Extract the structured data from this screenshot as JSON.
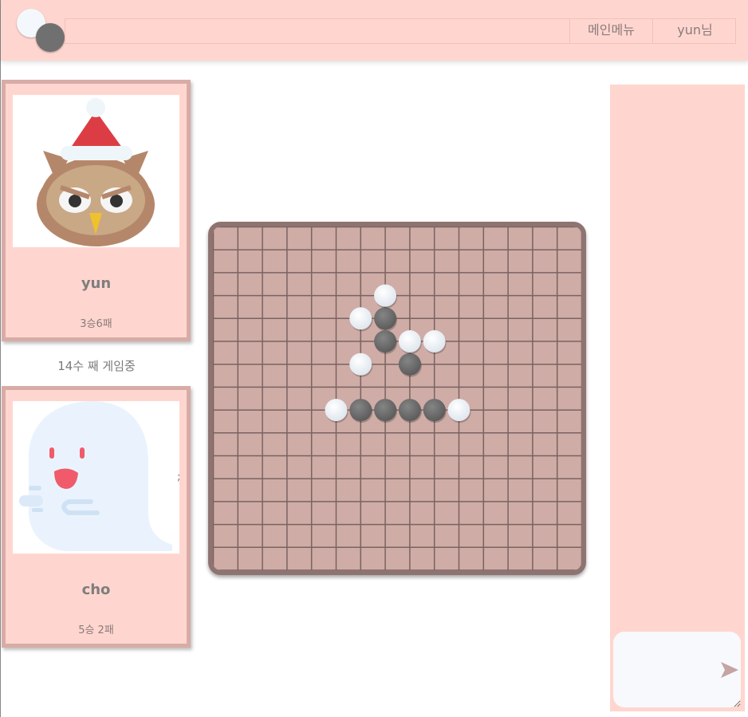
{
  "header": {
    "menu_label": "메인메뉴",
    "user_label": "yun님"
  },
  "players": [
    {
      "name": "yun",
      "record": "3승6패",
      "avatar": "owl-santa-hat-icon"
    },
    {
      "name": "cho",
      "record": "5승 2패",
      "avatar": "ghost-icon"
    }
  ],
  "game": {
    "status": "14수 째 게임중",
    "black_stones": [
      [
        7,
        4
      ],
      [
        7,
        5
      ],
      [
        8,
        6
      ],
      [
        6,
        8
      ],
      [
        7,
        8
      ],
      [
        8,
        8
      ],
      [
        9,
        8
      ]
    ],
    "white_stones": [
      [
        7,
        3
      ],
      [
        6,
        4
      ],
      [
        8,
        5
      ],
      [
        9,
        5
      ],
      [
        6,
        6
      ],
      [
        5,
        8
      ],
      [
        10,
        8
      ]
    ]
  },
  "stray_text": ";",
  "chat": {
    "placeholder": "",
    "send_icon": "send-arrow-icon"
  },
  "colors": {
    "header_bg": "#ffd6cf",
    "board_bg": "#cfaca6",
    "board_border": "#8e7370",
    "grid_line": "#7a6361",
    "black_stone": "#707070",
    "white_stone": "#f4f8fc"
  }
}
